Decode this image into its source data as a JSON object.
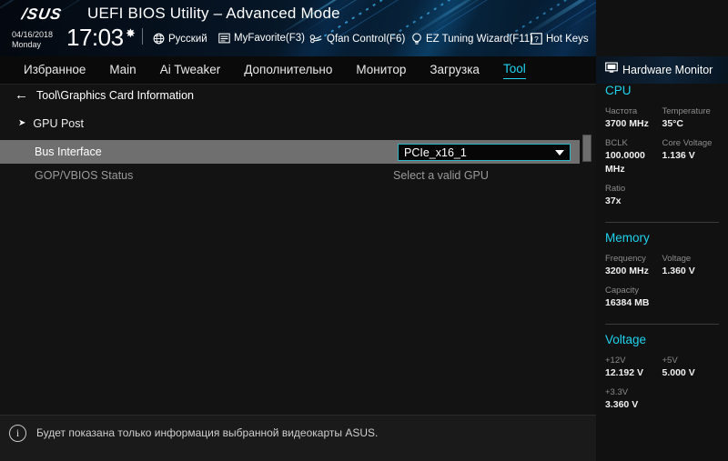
{
  "header": {
    "logo": "/SUS",
    "title": "UEFI BIOS Utility – Advanced Mode",
    "date": "04/16/2018",
    "weekday": "Monday",
    "time": "17:03",
    "gear_icon": "gear-icon",
    "items": [
      {
        "icon": "globe-icon",
        "label": "Русский"
      },
      {
        "icon": "star-window-icon",
        "label": "MyFavorite(F3)"
      },
      {
        "icon": "fan-icon",
        "label": "Qfan Control(F6)"
      },
      {
        "icon": "bulb-icon",
        "label": "EZ Tuning Wizard(F11)"
      },
      {
        "icon": "question-box-icon",
        "label": "Hot Keys"
      }
    ]
  },
  "nav": {
    "tabs": [
      {
        "label": "Избранное",
        "active": false
      },
      {
        "label": "Main",
        "active": false
      },
      {
        "label": "Ai Tweaker",
        "active": false
      },
      {
        "label": "Дополнительно",
        "active": false
      },
      {
        "label": "Монитор",
        "active": false
      },
      {
        "label": "Загрузка",
        "active": false
      },
      {
        "label": "Tool",
        "active": true
      }
    ]
  },
  "main": {
    "breadcrumb": "Tool\\Graphics Card Information",
    "back_icon": "back-arrow-icon",
    "submenu": {
      "arrow": "➤",
      "label": "GPU Post"
    },
    "rows": [
      {
        "label": "Bus Interface",
        "control": "dropdown",
        "value": "PCIe_x16_1",
        "selected": true
      },
      {
        "label": "GOP/VBIOS Status",
        "control": "text",
        "value": "Select a valid GPU",
        "selected": false
      }
    ]
  },
  "footer": {
    "icon": "info-icon",
    "icon_glyph": "i",
    "help_text": "Будет показана только информация выбранной видеокарты ASUS."
  },
  "sidebar": {
    "title": "Hardware Monitor",
    "title_icon": "monitor-icon",
    "sections": [
      {
        "name": "CPU",
        "pairs": [
          {
            "key": "Частота",
            "value": "3700 MHz",
            "key2": "Temperature",
            "value2": "35°C"
          },
          {
            "key": "BCLK",
            "value": "100.0000 MHz",
            "key2": "Core Voltage",
            "value2": "1.136 V"
          },
          {
            "key": "Ratio",
            "value": "37x",
            "key2": "",
            "value2": ""
          }
        ]
      },
      {
        "name": "Memory",
        "pairs": [
          {
            "key": "Frequency",
            "value": "3200 MHz",
            "key2": "Voltage",
            "value2": "1.360 V"
          },
          {
            "key": "Capacity",
            "value": "16384 MB",
            "key2": "",
            "value2": ""
          }
        ]
      },
      {
        "name": "Voltage",
        "pairs": [
          {
            "key": "+12V",
            "value": "12.192 V",
            "key2": "+5V",
            "value2": "5.000 V"
          },
          {
            "key": "+3.3V",
            "value": "3.360 V",
            "key2": "",
            "value2": ""
          }
        ]
      }
    ]
  },
  "colors": {
    "accent_cyan": "#1fd2ee",
    "dropdown_border": "#2fb5c8",
    "selected_row": "#6f6f6f",
    "pane_bg": "#131313"
  }
}
